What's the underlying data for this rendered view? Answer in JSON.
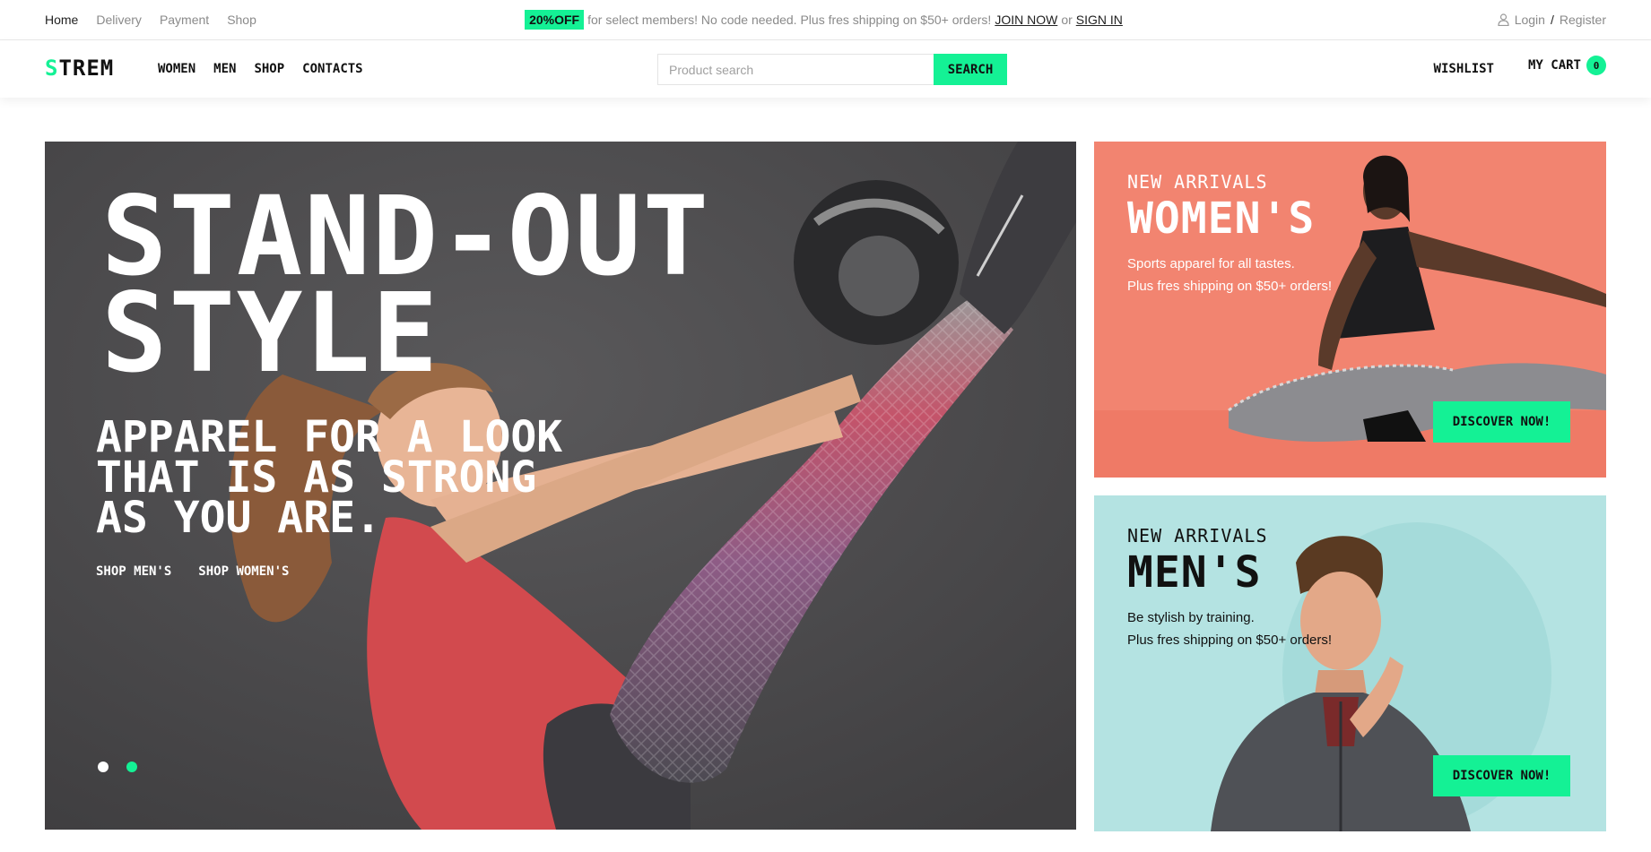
{
  "topbar": {
    "nav": [
      {
        "label": "Home",
        "active": true
      },
      {
        "label": "Delivery",
        "active": false
      },
      {
        "label": "Payment",
        "active": false
      },
      {
        "label": "Shop",
        "active": false
      }
    ],
    "promo": {
      "badge": "20%OFF",
      "text": "for select members! No code needed. Plus fres shipping on $50+ orders!",
      "join": "JOIN NOW",
      "or": "or",
      "signin": "SIGN IN"
    },
    "account": {
      "icon": "user-icon",
      "login": "Login",
      "separator": "/",
      "register": "Register"
    }
  },
  "header": {
    "logo_first": "S",
    "logo_rest": "TREM",
    "nav": [
      "WOMEN",
      "MEN",
      "SHOP",
      "CONTACTS"
    ],
    "search": {
      "placeholder": "Product search",
      "value": "",
      "button": "SEARCH"
    },
    "wishlist": "WISHLIST",
    "cart_label": "MY CART",
    "cart_count": "0"
  },
  "hero": {
    "title_line1": "STAND-OUT",
    "title_line2": "STYLE",
    "sub_line1": "APPAREL FOR A LOOK",
    "sub_line2": "THAT IS AS STRONG",
    "sub_line3": "AS YOU ARE.",
    "links": [
      "SHOP MEN'S",
      "SHOP WOMEN'S"
    ],
    "slides": 2,
    "active_slide": 2
  },
  "banners": {
    "women": {
      "eyebrow": "NEW ARRIVALS",
      "title": "WOMEN'S",
      "desc_line1": "Sports apparel for all tastes.",
      "desc_line2": "Plus fres shipping on $50+ orders!",
      "button": "DISCOVER NOW!"
    },
    "men": {
      "eyebrow": "NEW ARRIVALS",
      "title": "MEN'S",
      "desc_line1": "Be stylish by training.",
      "desc_line2": "Plus fres shipping on $50+ orders!",
      "button": "DISCOVER NOW!"
    }
  },
  "colors": {
    "accent": "#14f195",
    "hero_bg": "#4b4a4c",
    "women_bg": "#f28470",
    "men_bg": "#b4e3e2"
  }
}
